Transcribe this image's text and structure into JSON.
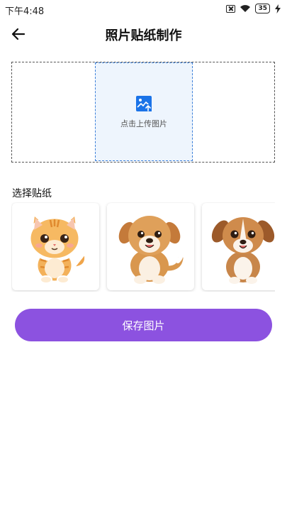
{
  "status_bar": {
    "time": "下午4:48",
    "battery": "35",
    "icons": [
      "sim-off-icon",
      "wifi-icon",
      "battery-icon",
      "charging-icon"
    ]
  },
  "header": {
    "title": "照片贴纸制作",
    "back_icon": "arrow-left-icon"
  },
  "upload": {
    "label": "点击上传图片",
    "icon": "image-upload-icon",
    "accent": "#1a73e8"
  },
  "stickers": {
    "title": "选择贴纸",
    "items": [
      {
        "name": "orange-cat"
      },
      {
        "name": "puppy-1"
      },
      {
        "name": "puppy-2"
      }
    ]
  },
  "save_button": {
    "label": "保存图片",
    "color": "#8c52e0"
  }
}
